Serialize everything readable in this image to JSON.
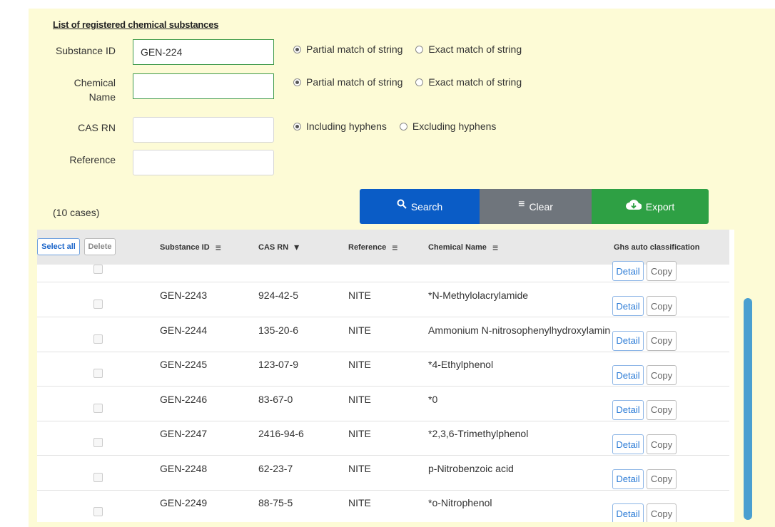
{
  "form": {
    "title": "List of registered chemical substances",
    "substance_id": {
      "label": "Substance ID",
      "value": "GEN-224",
      "partial": "Partial match of string",
      "exact": "Exact match of string"
    },
    "chemical_name": {
      "label1": "Chemical",
      "label2": "Name",
      "value": "",
      "partial": "Partial match of string",
      "exact": "Exact match of string"
    },
    "cas_rn": {
      "label": "CAS RN",
      "value": "",
      "including": "Including hyphens",
      "excluding": "Excluding hyphens"
    },
    "reference": {
      "label": "Reference",
      "value": ""
    }
  },
  "actions": {
    "search": "Search",
    "clear": "Clear",
    "export": "Export"
  },
  "cases": "(10 cases)",
  "table": {
    "select_all": "Select all",
    "delete": "Delete",
    "headers": {
      "substance_id": "Substance ID",
      "cas_rn": "CAS RN",
      "reference": "Reference",
      "chemical_name": "Chemical Name",
      "ghs": "Ghs auto classification"
    },
    "detail_label": "Detail",
    "copy_label": "Copy",
    "rows": [
      {
        "id": "GEN-2243",
        "cas": "924-42-5",
        "ref": "NITE",
        "name": "*N-Methylolacrylamide"
      },
      {
        "id": "GEN-2244",
        "cas": "135-20-6",
        "ref": "NITE",
        "name": "Ammonium N-nitrosophenylhydroxylamine"
      },
      {
        "id": "GEN-2245",
        "cas": "123-07-9",
        "ref": "NITE",
        "name": "*4-Ethylphenol"
      },
      {
        "id": "GEN-2246",
        "cas": "83-67-0",
        "ref": "NITE",
        "name": "*0"
      },
      {
        "id": "GEN-2247",
        "cas": "2416-94-6",
        "ref": "NITE",
        "name": "*2,3,6-Trimethylphenol"
      },
      {
        "id": "GEN-2248",
        "cas": "62-23-7",
        "ref": "NITE",
        "name": "p-Nitrobenzoic acid"
      },
      {
        "id": "GEN-2249",
        "cas": "88-75-5",
        "ref": "NITE",
        "name": "*o-Nitrophenol"
      }
    ]
  },
  "colors": {
    "panel": "#fdfbd6",
    "search": "#0a5cc6",
    "clear": "#6f757c",
    "export": "#2ea044",
    "scrollbar": "#4a9fd0"
  }
}
